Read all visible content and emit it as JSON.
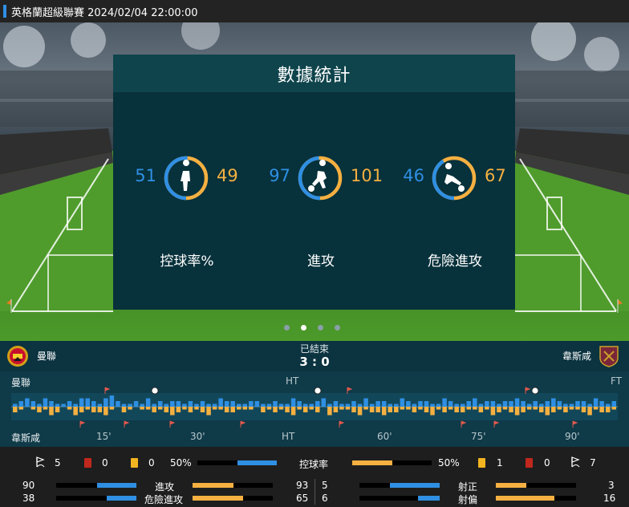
{
  "header": {
    "title": "英格蘭超級聯賽 2024/02/04 22:00:00"
  },
  "panel": {
    "title": "數據統計",
    "stats": [
      {
        "home": "51",
        "away": "49",
        "label": "控球率%",
        "icon": "player-standing-icon",
        "home_share": 0.51
      },
      {
        "home": "97",
        "away": "101",
        "label": "進攻",
        "icon": "player-kicking-icon",
        "home_share": 0.49
      },
      {
        "home": "46",
        "away": "67",
        "label": "危險進攻",
        "icon": "player-sliding-icon",
        "home_share": 0.41
      }
    ],
    "carousel_pages": 4,
    "carousel_active": 1
  },
  "match": {
    "home": "曼聯",
    "away": "韋斯咸",
    "status": "已結束",
    "score": "3 : 0"
  },
  "timeline": {
    "home_label": "曼聯",
    "away_label": "韋斯咸",
    "ht_top": "HT",
    "ft_top": "FT",
    "ticks": [
      "15'",
      "30'",
      "HT",
      "60'",
      "75'",
      "90'"
    ],
    "home_bars": [
      1,
      2,
      3,
      2,
      1,
      3,
      2,
      1,
      1,
      2,
      1,
      3,
      3,
      2,
      1,
      3,
      4,
      2,
      1,
      1,
      2,
      1,
      3,
      1,
      2,
      1,
      2,
      2,
      1,
      2,
      1,
      2,
      1,
      1,
      3,
      2,
      2,
      1,
      1,
      2,
      2,
      1,
      1,
      2,
      1,
      1,
      3,
      2,
      1,
      1,
      2,
      3,
      1,
      2,
      1,
      1,
      2,
      1,
      3,
      1,
      2,
      2,
      1,
      1,
      3,
      2,
      1,
      2,
      2,
      1,
      1,
      3,
      2,
      1,
      1,
      2,
      3,
      1,
      2,
      2,
      1,
      2,
      2,
      3,
      2,
      1,
      2,
      1,
      2,
      3,
      2,
      1,
      1,
      2,
      2,
      1,
      3,
      2,
      1,
      2
    ],
    "away_bars": [
      2,
      1,
      0,
      1,
      2,
      1,
      3,
      2,
      0,
      1,
      3,
      2,
      1,
      2,
      2,
      3,
      1,
      0,
      2,
      1,
      0,
      1,
      1,
      2,
      1,
      2,
      3,
      2,
      1,
      2,
      1,
      2,
      3,
      1,
      1,
      2,
      2,
      1,
      1,
      1,
      0,
      2,
      1,
      2,
      1,
      2,
      3,
      1,
      2,
      1,
      2,
      0,
      3,
      2,
      1,
      1,
      2,
      3,
      1,
      2,
      2,
      3,
      2,
      2,
      1,
      1,
      2,
      1,
      2,
      3,
      1,
      2,
      1,
      2,
      2,
      1,
      1,
      2,
      1,
      3,
      2,
      1,
      2,
      3,
      2,
      1,
      1,
      2,
      3,
      2,
      1,
      2,
      1,
      1,
      2,
      3,
      1,
      2,
      2,
      1
    ]
  },
  "colors": {
    "home": "#2f8fe3",
    "away": "#f5b041",
    "yellow_card": "#f2b521",
    "red_card": "#c0281d"
  },
  "summary": {
    "home_corners": "5",
    "home_red": "0",
    "home_yellow": "0",
    "home_possession": "50%",
    "possession_label": "控球率",
    "away_possession": "50%",
    "away_yellow": "1",
    "away_red": "0",
    "away_corners": "7",
    "rows_left": [
      {
        "home": "90",
        "label": "進攻",
        "away": "93",
        "home_share": 0.49,
        "away_share": 0.51
      },
      {
        "home": "38",
        "label": "危險進攻",
        "away": "65",
        "home_share": 0.37,
        "away_share": 0.63
      }
    ],
    "rows_right": [
      {
        "home": "5",
        "label": "射正",
        "away": "3",
        "home_share": 0.62,
        "away_share": 0.38
      },
      {
        "home": "6",
        "label": "射偏",
        "away": "16",
        "home_share": 0.27,
        "away_share": 0.73
      }
    ],
    "possession_home_share": 0.5,
    "possession_away_share": 0.5
  }
}
